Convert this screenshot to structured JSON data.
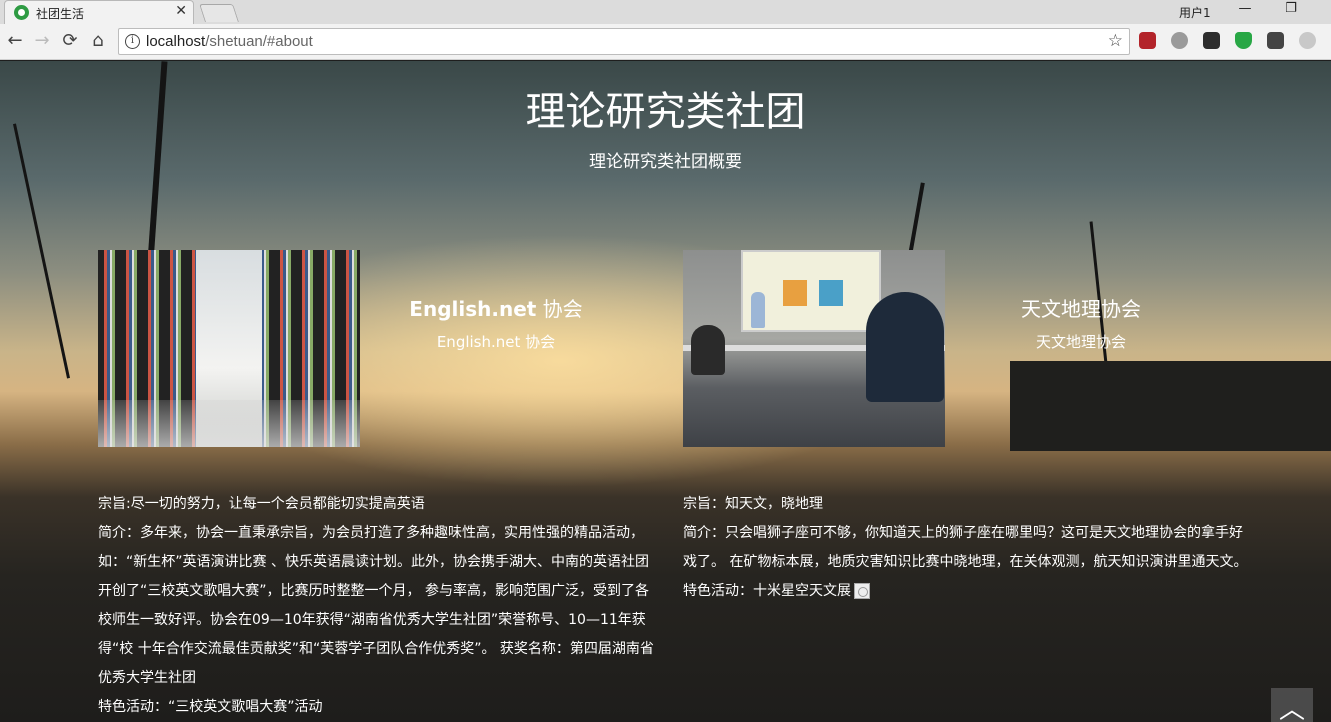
{
  "browser": {
    "tab_title": "社团生活",
    "tab_close": "✕",
    "user_label": "用户1",
    "url_host": "localhost",
    "url_path": "/shetuan/#about",
    "back_icon": "←",
    "forward_icon": "→",
    "reload_icon": "⟳",
    "home_icon": "⌂",
    "star_icon": "☆",
    "minimize_icon": "—",
    "restore_icon": "❐",
    "extension_colors": [
      "#b3242a",
      "#9a9a9a",
      "#2d2d2d",
      "#28a745",
      "#444444",
      "#c8c8c8"
    ]
  },
  "page": {
    "title": "理论研究类社团",
    "subtitle": "理论研究类社团概要",
    "clubs": [
      {
        "name_bold": "English.net",
        "name_rest": " 协会",
        "subname": "English.net 协会",
        "image": "library-bookshelves",
        "lines": [
          "宗旨:尽一切的努力，让每一个会员都能切实提高英语",
          "简介：多年来，协会一直秉承宗旨，为会员打造了多种趣味性高，实用性强的精品活动，如：“新生杯”英语演讲比赛 、快乐英语晨读计划。此外，协会携手湖大、中南的英语社团开创了“三校英文歌唱大赛”，比赛历时整整一个月， 参与率高，影响范围广泛，受到了各校师生一致好评。协会在09—10年获得“湖南省优秀大学生社团”荣誉称号、10—11年获得“校 十年合作交流最佳贡献奖”和“芙蓉学子团队合作优秀奖”。 获奖名称：第四届湖南省优秀大学生社团",
          "特色活动：“三校英文歌唱大赛”活动"
        ]
      },
      {
        "name": "天文地理协会",
        "subname": "天文地理协会",
        "image": "classroom-presentation",
        "lines": [
          "宗旨：知天文，晓地理",
          "简介：只会唱狮子座可不够，你知道天上的狮子座在哪里吗？这可是天文地理协会的拿手好戏了。 在矿物标本展，地质灾害知识比赛中晓地理，在关体观测，航天知识演讲里通天文。",
          "特色活动：十米星空天文展"
        ]
      }
    ],
    "back_to_top_icon": "chevron-up-icon"
  }
}
